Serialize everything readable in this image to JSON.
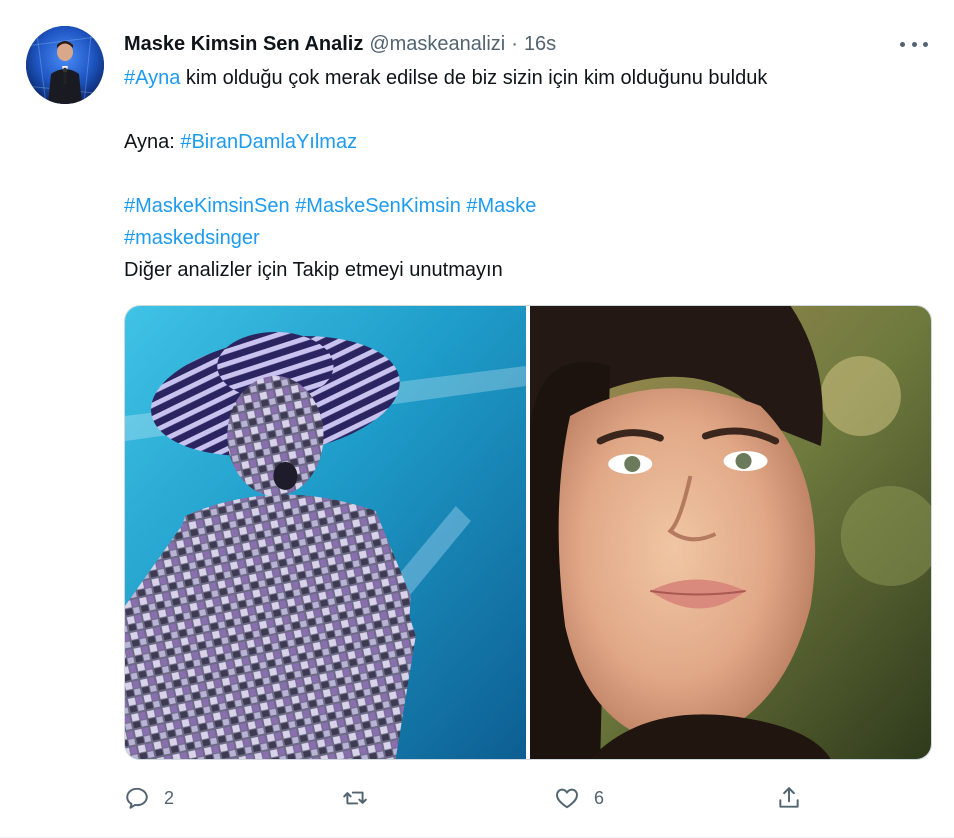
{
  "tweet": {
    "author_name": "Maske Kimsin Sen Analiz",
    "author_handle": "@maskeanalizi",
    "separator": "·",
    "time": "16s",
    "lines": {
      "l1_tag": "#Ayna",
      "l1_text": " kim olduğu çok merak edilse de biz sizin için kim olduğunu bulduk",
      "l2_prefix": "Ayna: ",
      "l2_tag": "#BiranDamlaYılmaz",
      "tag_a": "#MaskeKimsinSen",
      "tag_b": "#MaskeSenKimsin",
      "tag_c": "#Maske",
      "tag_d": "#maskedsinger",
      "closing": "Diğer analizler için Takip etmeyi unutmayın"
    }
  },
  "actions": {
    "reply_count": "2",
    "retweet_count": "",
    "like_count": "6"
  },
  "icons": {
    "more": "more-icon",
    "reply": "reply-icon",
    "retweet": "retweet-icon",
    "like": "like-icon",
    "share": "share-icon"
  },
  "colors": {
    "link": "#1d9bf0",
    "secondary": "#536471",
    "text": "#0f1419",
    "border": "#cfd9de"
  }
}
